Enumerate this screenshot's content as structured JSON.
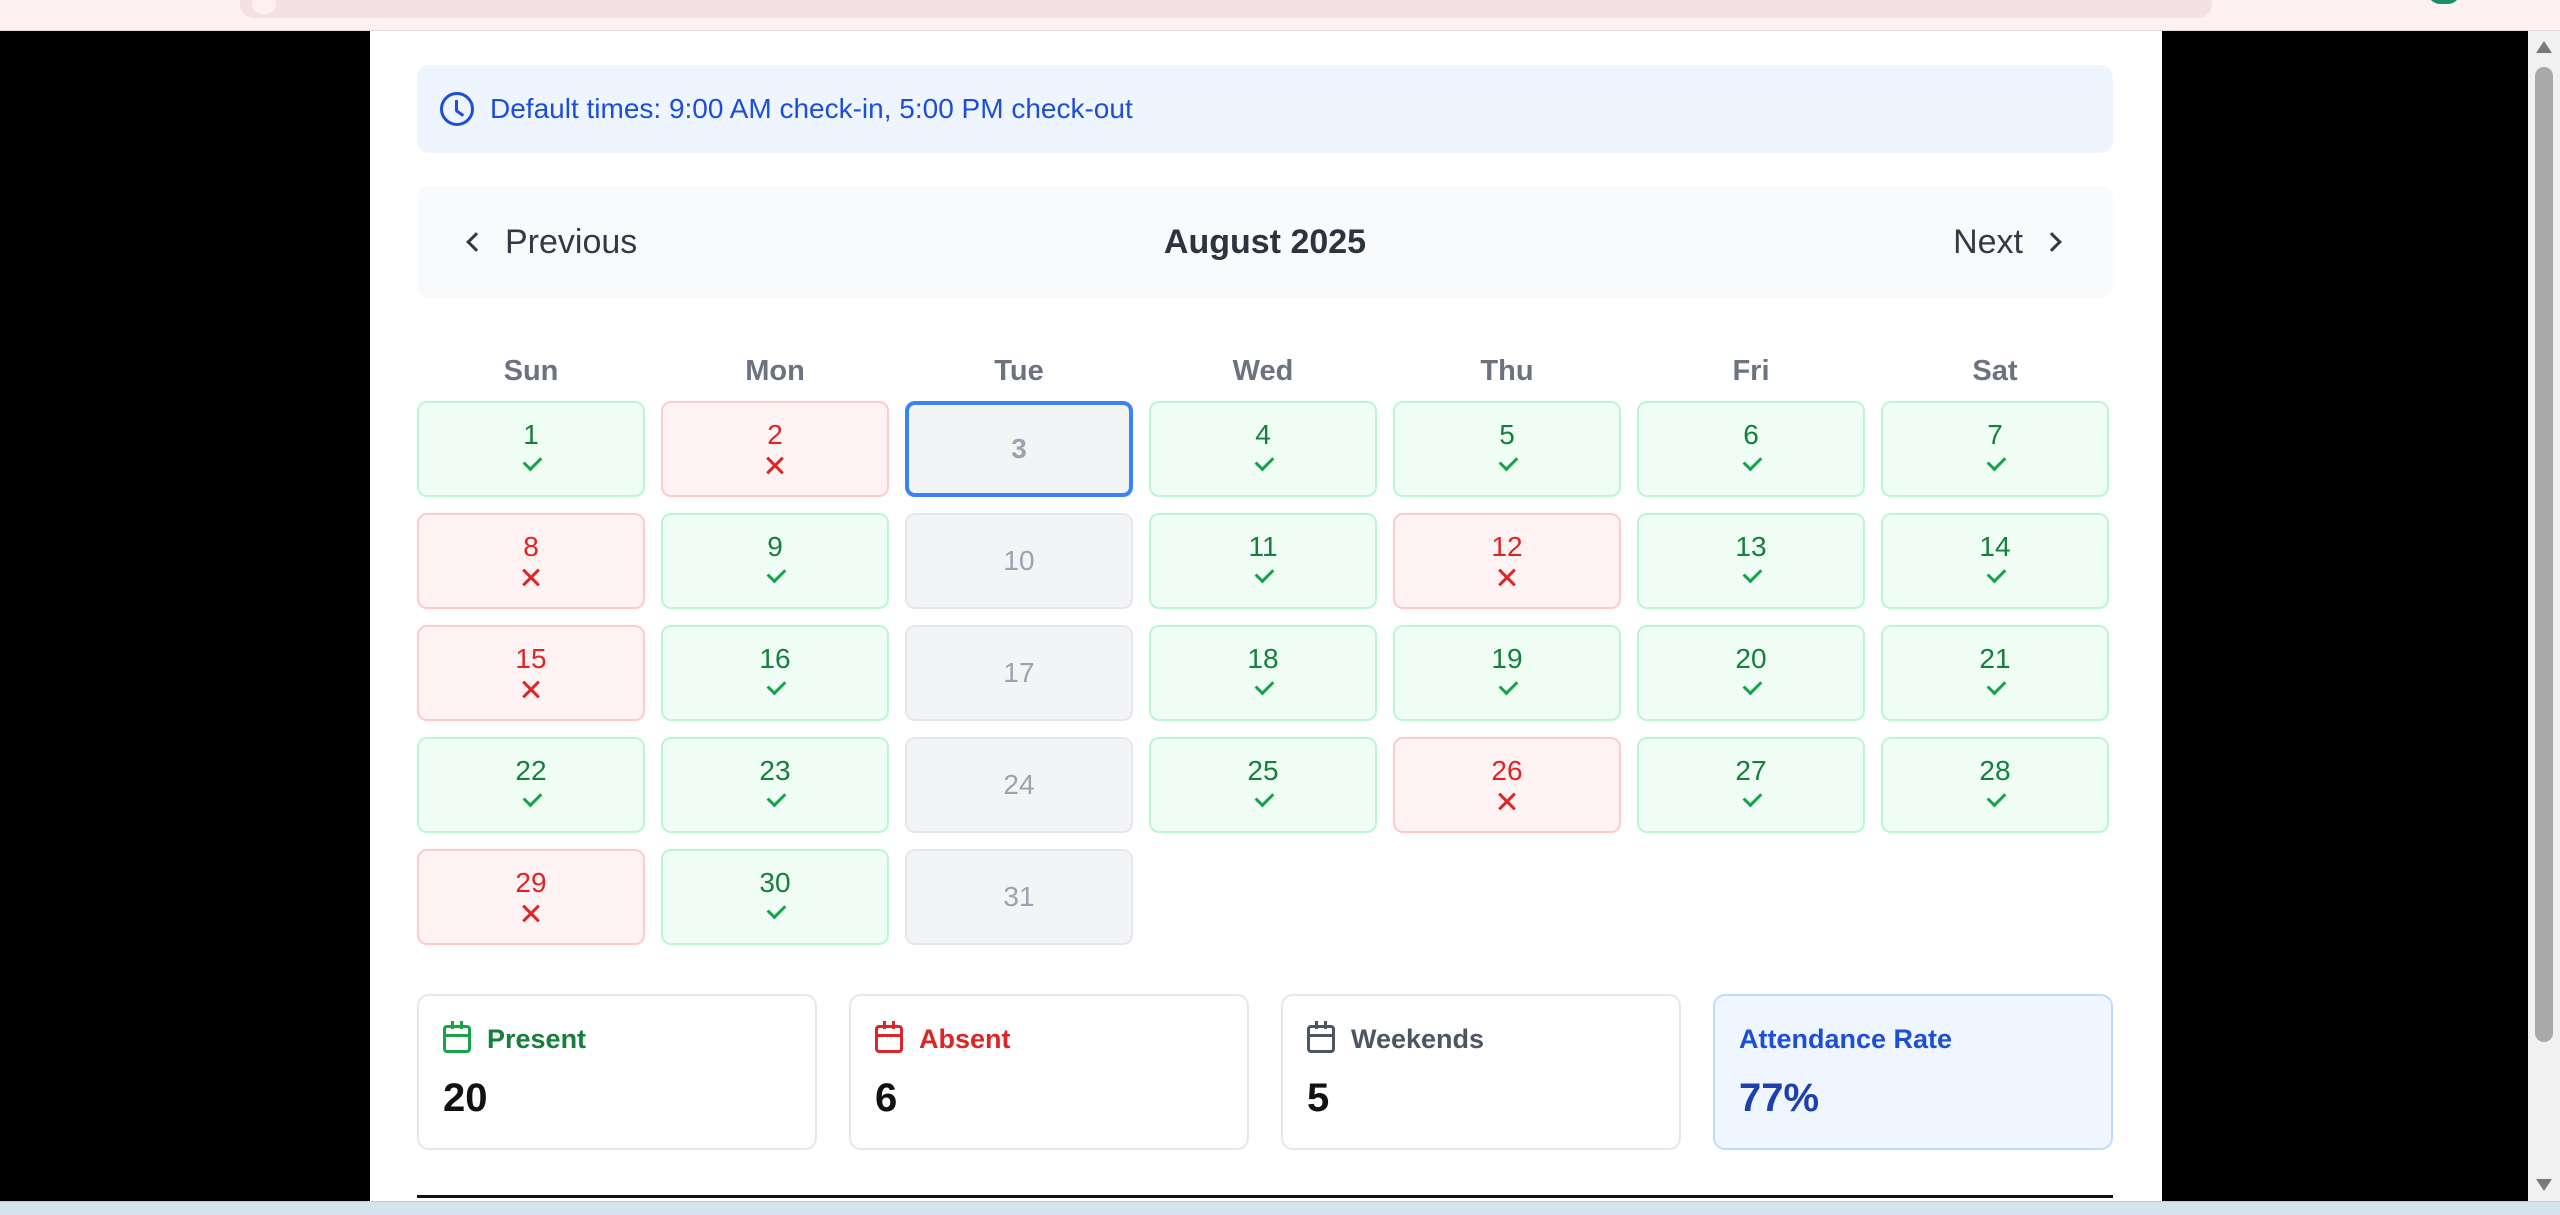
{
  "banner": {
    "text": "Default times: 9:00 AM check-in, 5:00 PM check-out",
    "icon": "clock-icon"
  },
  "nav": {
    "prev_label": "Previous",
    "next_label": "Next",
    "month_title": "August 2025"
  },
  "weekdays": [
    "Sun",
    "Mon",
    "Tue",
    "Wed",
    "Thu",
    "Fri",
    "Sat"
  ],
  "days": [
    {
      "day": "1",
      "status": "present"
    },
    {
      "day": "2",
      "status": "absent"
    },
    {
      "day": "3",
      "status": "today"
    },
    {
      "day": "4",
      "status": "present"
    },
    {
      "day": "5",
      "status": "present"
    },
    {
      "day": "6",
      "status": "present"
    },
    {
      "day": "7",
      "status": "present"
    },
    {
      "day": "8",
      "status": "absent"
    },
    {
      "day": "9",
      "status": "present"
    },
    {
      "day": "10",
      "status": "weekend"
    },
    {
      "day": "11",
      "status": "present"
    },
    {
      "day": "12",
      "status": "absent"
    },
    {
      "day": "13",
      "status": "present"
    },
    {
      "day": "14",
      "status": "present"
    },
    {
      "day": "15",
      "status": "absent"
    },
    {
      "day": "16",
      "status": "present"
    },
    {
      "day": "17",
      "status": "weekend"
    },
    {
      "day": "18",
      "status": "present"
    },
    {
      "day": "19",
      "status": "present"
    },
    {
      "day": "20",
      "status": "present"
    },
    {
      "day": "21",
      "status": "present"
    },
    {
      "day": "22",
      "status": "present"
    },
    {
      "day": "23",
      "status": "present"
    },
    {
      "day": "24",
      "status": "weekend"
    },
    {
      "day": "25",
      "status": "present"
    },
    {
      "day": "26",
      "status": "absent"
    },
    {
      "day": "27",
      "status": "present"
    },
    {
      "day": "28",
      "status": "present"
    },
    {
      "day": "29",
      "status": "absent"
    },
    {
      "day": "30",
      "status": "present"
    },
    {
      "day": "31",
      "status": "weekend"
    }
  ],
  "stats": {
    "present": {
      "label": "Present",
      "value": "20",
      "icon": "calendar-check-icon"
    },
    "absent": {
      "label": "Absent",
      "value": "6",
      "icon": "calendar-x-icon"
    },
    "weekends": {
      "label": "Weekends",
      "value": "5",
      "icon": "calendar-x-icon"
    },
    "rate": {
      "label": "Attendance Rate",
      "value": "77%"
    }
  },
  "colors": {
    "present_text": "#15803d",
    "present_bg": "#f0fdf4",
    "absent_text": "#dc2626",
    "absent_bg": "#fef2f2",
    "weekend_text": "#9ca3af",
    "today_border": "#3b82f6",
    "accent_blue": "#1d4ed8"
  }
}
